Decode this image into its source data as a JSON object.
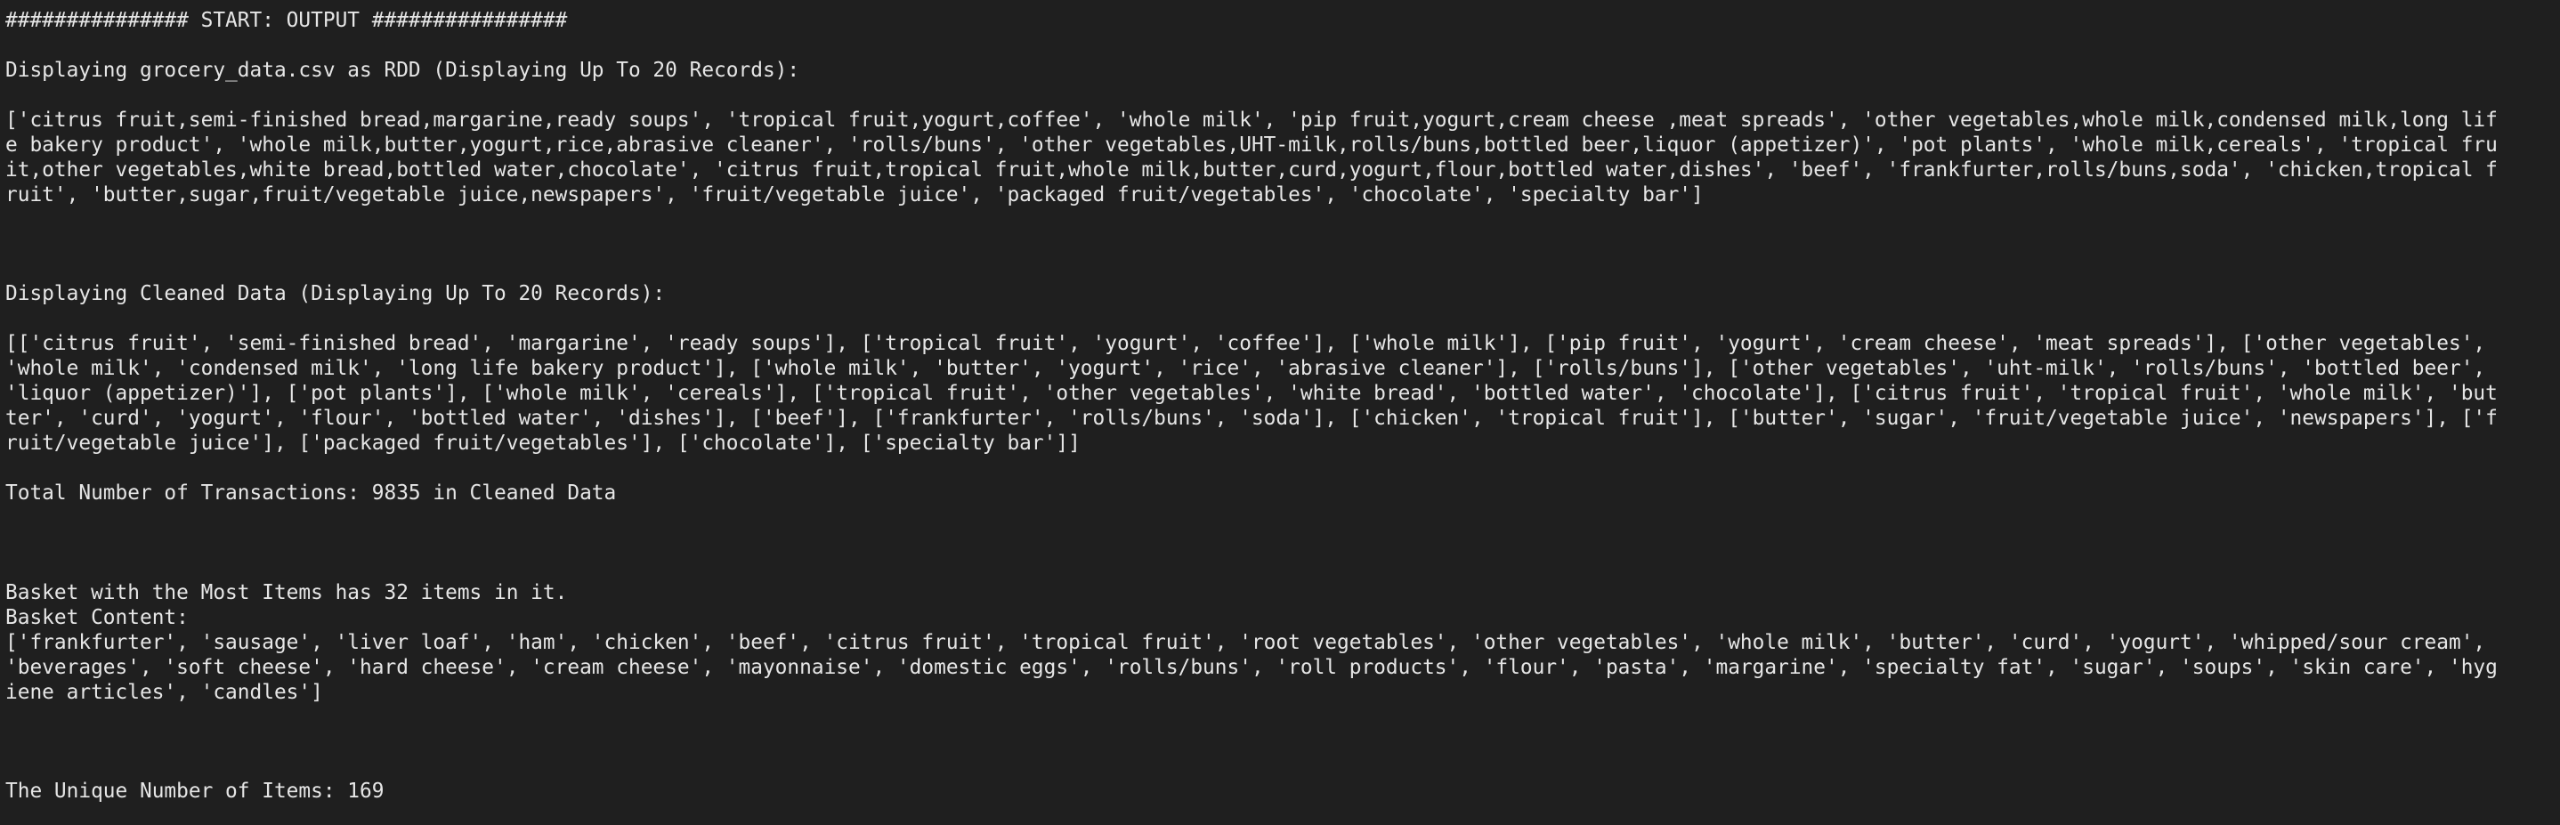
{
  "header": "############### START: OUTPUT ################",
  "rdd": {
    "title": "Displaying grocery_data.csv as RDD (Displaying Up To 20 Records):",
    "lines": [
      "['citrus fruit,semi-finished bread,margarine,ready soups', 'tropical fruit,yogurt,coffee', 'whole milk', 'pip fruit,yogurt,cream cheese ,meat spreads', 'other vegetables,whole milk,condensed milk,long lif",
      "e bakery product', 'whole milk,butter,yogurt,rice,abrasive cleaner', 'rolls/buns', 'other vegetables,UHT-milk,rolls/buns,bottled beer,liquor (appetizer)', 'pot plants', 'whole milk,cereals', 'tropical fru",
      "it,other vegetables,white bread,bottled water,chocolate', 'citrus fruit,tropical fruit,whole milk,butter,curd,yogurt,flour,bottled water,dishes', 'beef', 'frankfurter,rolls/buns,soda', 'chicken,tropical f",
      "ruit', 'butter,sugar,fruit/vegetable juice,newspapers', 'fruit/vegetable juice', 'packaged fruit/vegetables', 'chocolate', 'specialty bar']"
    ]
  },
  "cleaned": {
    "title": "Displaying Cleaned Data (Displaying Up To 20 Records):",
    "lines": [
      "[['citrus fruit', 'semi-finished bread', 'margarine', 'ready soups'], ['tropical fruit', 'yogurt', 'coffee'], ['whole milk'], ['pip fruit', 'yogurt', 'cream cheese', 'meat spreads'], ['other vegetables',",
      "'whole milk', 'condensed milk', 'long life bakery product'], ['whole milk', 'butter', 'yogurt', 'rice', 'abrasive cleaner'], ['rolls/buns'], ['other vegetables', 'uht-milk', 'rolls/buns', 'bottled beer',",
      "'liquor (appetizer)'], ['pot plants'], ['whole milk', 'cereals'], ['tropical fruit', 'other vegetables', 'white bread', 'bottled water', 'chocolate'], ['citrus fruit', 'tropical fruit', 'whole milk', 'but",
      "ter', 'curd', 'yogurt', 'flour', 'bottled water', 'dishes'], ['beef'], ['frankfurter', 'rolls/buns', 'soda'], ['chicken', 'tropical fruit'], ['butter', 'sugar', 'fruit/vegetable juice', 'newspapers'], ['f",
      "ruit/vegetable juice'], ['packaged fruit/vegetables'], ['chocolate'], ['specialty bar']]"
    ],
    "total": "Total Number of Transactions: 9835 in Cleaned Data"
  },
  "basket": {
    "title": "Basket with the Most Items has 32 items in it.",
    "content_label": "Basket Content:",
    "lines": [
      "['frankfurter', 'sausage', 'liver loaf', 'ham', 'chicken', 'beef', 'citrus fruit', 'tropical fruit', 'root vegetables', 'other vegetables', 'whole milk', 'butter', 'curd', 'yogurt', 'whipped/sour cream',",
      "'beverages', 'soft cheese', 'hard cheese', 'cream cheese', 'mayonnaise', 'domestic eggs', 'rolls/buns', 'roll products', 'flour', 'pasta', 'margarine', 'specialty fat', 'sugar', 'soups', 'skin care', 'hyg",
      "iene articles', 'candles']"
    ]
  },
  "unique": "The Unique Number of Items: 169"
}
